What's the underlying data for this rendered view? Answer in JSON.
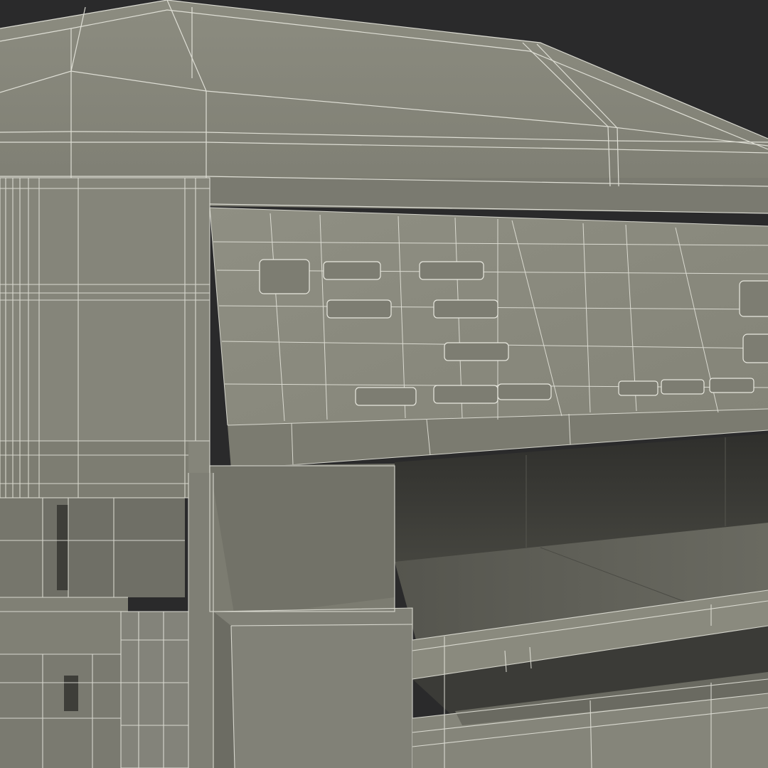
{
  "scene": {
    "subject": "printer-wireframe-render",
    "colors": {
      "background": "#2a2a2b",
      "surface": "#85857a",
      "surface_light": "#9a9a8e",
      "surface_dark": "#6e6e64",
      "shadow": "#4a4a44",
      "cavity": "#3c3c38",
      "wire": "#e8e8df"
    }
  }
}
